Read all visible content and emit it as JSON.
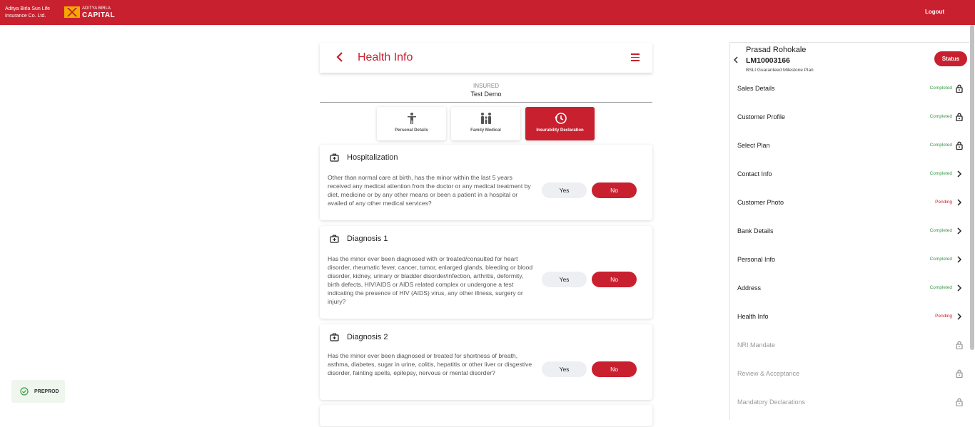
{
  "topbar": {
    "brand_line1": "Aditya Birla Sun Life",
    "brand_line2": "Insurance Co. Ltd.",
    "capital_top": "ADITYA BIRLA",
    "capital_main": "CAPITAL",
    "logout_label": "Logout"
  },
  "page": {
    "title": "Health Info",
    "back_icon": "chevron-left-icon",
    "menu_icon": "hamburger-menu-icon"
  },
  "insured": {
    "label": "INSURED",
    "name": "Test Demo"
  },
  "tabs": [
    {
      "label": "Personal Details",
      "icon": "person-icon",
      "active": false
    },
    {
      "label": "Family Medical",
      "icon": "family-icon",
      "active": false
    },
    {
      "label": "Insurability Declaration",
      "icon": "history-clock-icon",
      "active": true
    }
  ],
  "questions": [
    {
      "title": "Hospitalization",
      "text": "Other than normal care at birth, has the minor within the last 5 years received any medical attention from the doctor or any medical treatment by diet, medicine or by any other means or been a patient in a hospital or availed of any other medical services?",
      "yes_label": "Yes",
      "no_label": "No",
      "selected": "No"
    },
    {
      "title": "Diagnosis 1",
      "text": "Has the minor ever been diagnosed with or treated/consulted for heart disorder, rheumatic fever, cancer, tumor, enlarged glands, bleeding or blood disorder, kidney, urinary or bladder disorder/infection, arthritis, deformity, birth defects, HIV/AIDS or AIDS related complex or undergone a test indicating the presence of HIV (AIDS) virus, any other illness, surgery or injury?",
      "yes_label": "Yes",
      "no_label": "No",
      "selected": "No"
    },
    {
      "title": "Diagnosis 2",
      "text": "Has the minor ever been diagnosed or treated for shortness of breath, asthma, diabetes, sugar in urine, colitis, hepatitis or other liver or disgestive disorder, fainting spells, epilepsy, nervous or mental disorder?",
      "yes_label": "Yes",
      "no_label": "No",
      "selected": "No"
    }
  ],
  "sidepanel": {
    "name": "Prasad Rohokale",
    "lead_id": "LM10003166",
    "plan": "BSLI Guaranteed Milestone Plan",
    "status_label": "Status",
    "items": [
      {
        "label": "Sales Details",
        "status": "Completed",
        "icon": "lock-icon",
        "enabled": true
      },
      {
        "label": "Customer Profile",
        "status": "Completed",
        "icon": "lock-icon",
        "enabled": true
      },
      {
        "label": "Select Plan",
        "status": "Completed",
        "icon": "lock-icon",
        "enabled": true
      },
      {
        "label": "Contact Info",
        "status": "Completed",
        "icon": "chevron-right-icon",
        "enabled": true
      },
      {
        "label": "Customer Photo",
        "status": "Pending",
        "icon": "chevron-right-icon",
        "enabled": true
      },
      {
        "label": "Bank Details",
        "status": "Completed",
        "icon": "chevron-right-icon",
        "enabled": true
      },
      {
        "label": "Personal Info",
        "status": "Completed",
        "icon": "chevron-right-icon",
        "enabled": true
      },
      {
        "label": "Address",
        "status": "Completed",
        "icon": "chevron-right-icon",
        "enabled": true
      },
      {
        "label": "Health Info",
        "status": "Pending",
        "icon": "chevron-right-icon",
        "enabled": true
      },
      {
        "label": "NRI Mandate",
        "status": "",
        "icon": "lock-icon",
        "enabled": false
      },
      {
        "label": "Review & Acceptance",
        "status": "",
        "icon": "lock-icon",
        "enabled": false
      },
      {
        "label": "Mandatory Declarations",
        "status": "",
        "icon": "lock-icon",
        "enabled": false
      }
    ]
  },
  "env_badge": {
    "label": "PREPROD",
    "icon": "check-circle-icon"
  },
  "colors": {
    "brand_red": "#c8202f",
    "completed_green": "#3a9a4a",
    "pending_red": "#c8202f"
  }
}
